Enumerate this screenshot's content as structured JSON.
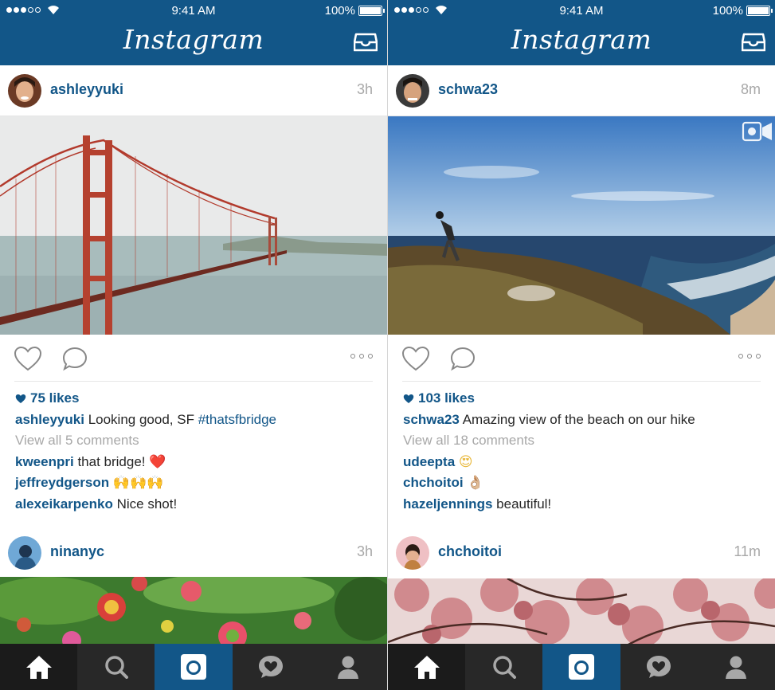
{
  "app": {
    "name": "Instagram"
  },
  "colors": {
    "brand_blue": "#125688",
    "tabbar": "#282828",
    "secondary_text": "#a8a8a8",
    "heart_red": "#e81c3c"
  },
  "screens": [
    {
      "status": {
        "time": "9:41 AM",
        "battery": "100%"
      },
      "posts": [
        {
          "username": "ashleyyuki",
          "time_ago": "3h",
          "photo_subject": "golden-gate-bridge",
          "likes": "75 likes",
          "caption": {
            "user": "ashleyyuki",
            "text": "Looking good, SF",
            "hashtag": "#thatsfbridge"
          },
          "view_comments": "View all 5 comments",
          "comments": [
            {
              "user": "kweenpri",
              "text": "that bridge!",
              "emoji": "❤️"
            },
            {
              "user": "jeffreydgerson",
              "text": "",
              "emoji": "🙌🙌🙌"
            },
            {
              "user": "alexeikarpenko",
              "text": "Nice shot!",
              "emoji": ""
            }
          ]
        },
        {
          "username": "ninanyc",
          "time_ago": "3h",
          "photo_subject": "pom-pom-flowers"
        }
      ]
    },
    {
      "status": {
        "time": "9:41 AM",
        "battery": "100%"
      },
      "posts": [
        {
          "username": "schwa23",
          "time_ago": "8m",
          "photo_subject": "beach-cliff-hiker",
          "is_video": true,
          "likes": "103 likes",
          "caption": {
            "user": "schwa23",
            "text": "Amazing view of the beach on our hike",
            "hashtag": ""
          },
          "view_comments": "View all 18 comments",
          "comments": [
            {
              "user": "udeepta",
              "text": "",
              "emoji": "😍"
            },
            {
              "user": "chchoitoi",
              "text": "",
              "emoji": "👌🏼"
            },
            {
              "user": "hazeljennings",
              "text": "beautiful!",
              "emoji": ""
            }
          ]
        },
        {
          "username": "chchoitoi",
          "time_ago": "11m",
          "photo_subject": "cherry-blossoms"
        }
      ]
    }
  ],
  "tabbar": [
    "home-icon",
    "search-icon",
    "camera-icon",
    "activity-icon",
    "profile-icon"
  ]
}
